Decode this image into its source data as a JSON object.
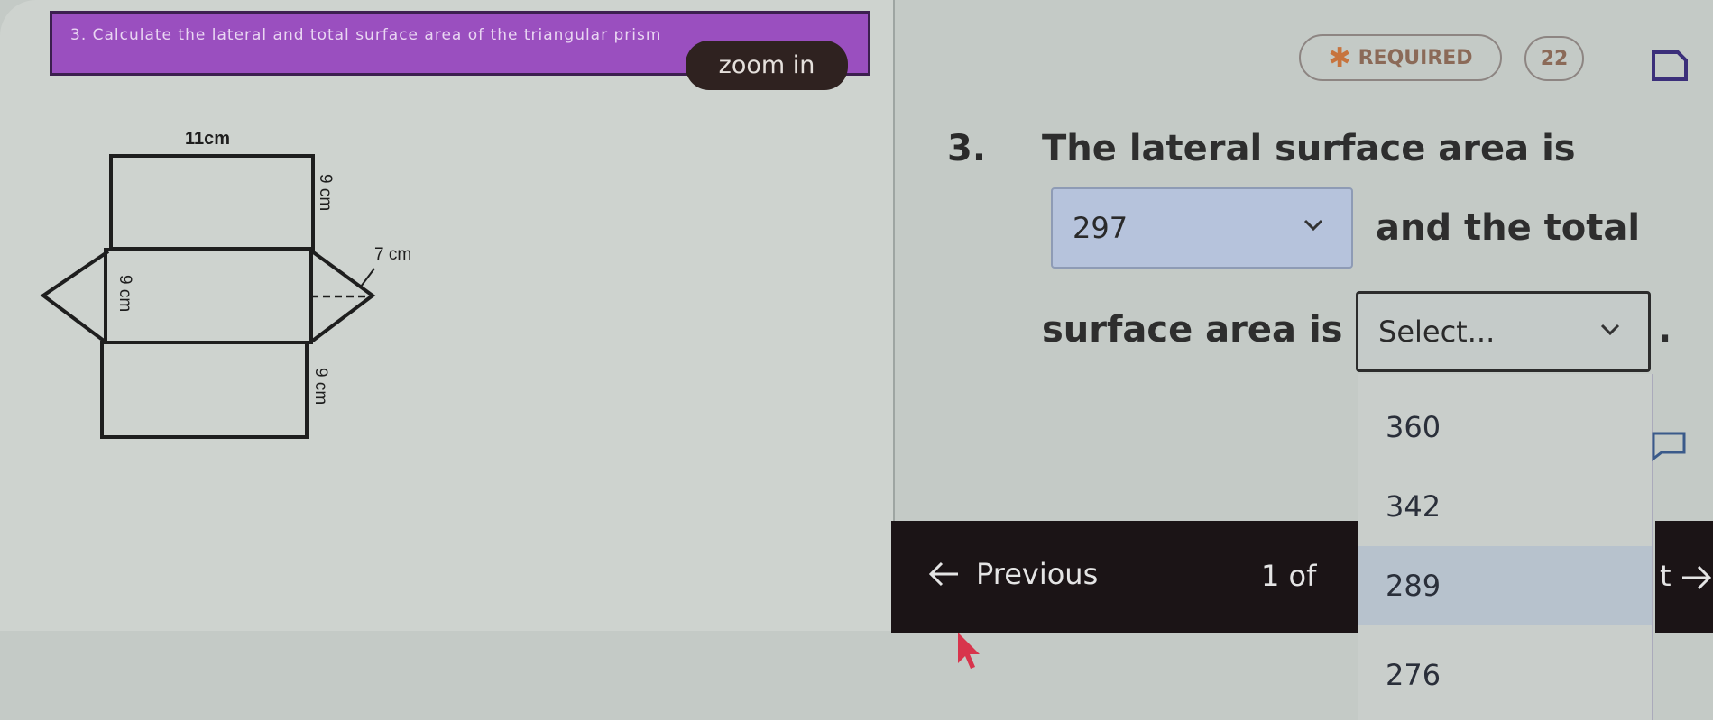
{
  "banner": {
    "text": "3. Calculate the lateral and total surface area of the triangular prism",
    "zoom_label": "zoom in",
    "color": "#9a4fbf"
  },
  "header": {
    "required_label": "REQUIRED",
    "required_icon": "asterisk-icon",
    "count": "22",
    "doc_icon": "document-icon"
  },
  "diagram": {
    "labels": {
      "top": "11cm",
      "side_top": "9 cm",
      "slant": "7 cm",
      "middle": "9 cm",
      "side_bottom": "9 cm"
    }
  },
  "question": {
    "number": "3.",
    "line1": "The lateral surface area is",
    "dropdown1": {
      "value": "297"
    },
    "line2": "and the total",
    "line3": "surface area is",
    "dropdown2": {
      "value": "Select...",
      "options": [
        "360",
        "342",
        "289",
        "276"
      ],
      "highlighted": "289"
    },
    "end": "."
  },
  "nav": {
    "previous_label": "Previous",
    "page_info": "1 of",
    "next_fragment": "t"
  }
}
